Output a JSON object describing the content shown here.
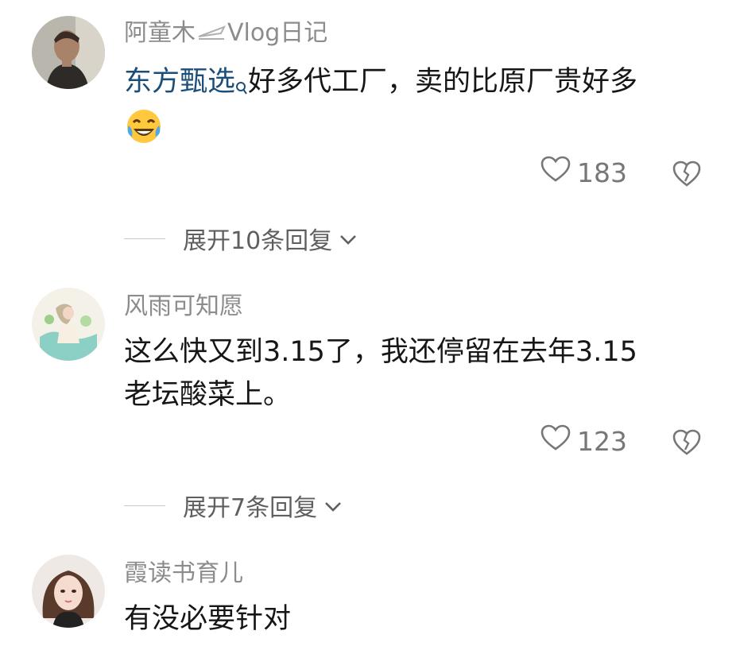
{
  "comments": [
    {
      "username": "阿童木",
      "username_suffix": "Vlog日记",
      "mention": "东方甄选",
      "text": "好多代工厂，卖的比原厂贵好多",
      "emoji": "laughing-crying-emoji",
      "likes": "183",
      "expand_label": "展开10条回复"
    },
    {
      "username": "风雨可知愿",
      "text_line1": "这么快又到3.15了，我还停留在去年3.15",
      "text_line2": "老坛酸菜上。",
      "likes": "123",
      "expand_label": "展开7条回复"
    },
    {
      "username": "霞读书育儿",
      "text": "有没必要针对"
    }
  ],
  "colors": {
    "username": "#8c8c8c",
    "mention": "#1b4f7a",
    "text": "#161616",
    "meta": "#777777"
  },
  "icons": [
    "heart-outline-icon",
    "broken-heart-icon",
    "chevron-down-icon",
    "search-icon",
    "airplane-icon"
  ]
}
